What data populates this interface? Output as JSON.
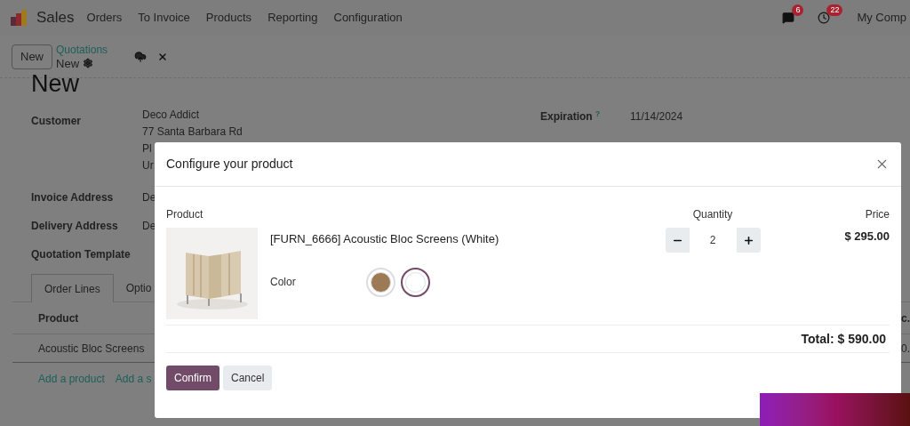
{
  "nav": {
    "app": "Sales",
    "menu": [
      "Orders",
      "To Invoice",
      "Products",
      "Reporting",
      "Configuration"
    ],
    "messages_badge": "6",
    "activities_badge": "22",
    "company": "My Comp"
  },
  "control_panel": {
    "new_button": "New",
    "breadcrumb": "Quotations",
    "record": "New"
  },
  "form": {
    "title": "New",
    "fields": [
      {
        "label": "Customer",
        "lines": [
          "Deco Addict",
          "77 Santa Barbara Rd",
          "Pl",
          "Ur"
        ]
      },
      {
        "label": "Invoice Address",
        "lines": [
          "De"
        ]
      },
      {
        "label": "Delivery Address",
        "lines": [
          "De"
        ]
      },
      {
        "label": "Quotation Template"
      }
    ],
    "expiration": {
      "label": "Expiration",
      "help": "?",
      "value": "11/14/2024"
    }
  },
  "tabs": [
    {
      "label": "Order Lines",
      "selected": true
    },
    {
      "label": "Optio",
      "selected": false
    }
  ],
  "order_lines": {
    "columns": [
      "Product",
      "c."
    ],
    "rows": [
      [
        "Acoustic Bloc Screens",
        "0."
      ]
    ],
    "actions": [
      "Add a product",
      "Add a s"
    ]
  },
  "dialog": {
    "title": "Configure your product",
    "columns": [
      "Product",
      "Quantity",
      "Price"
    ],
    "product": {
      "name": "[FURN_6666] Acoustic Bloc Screens (White)",
      "attribute_label": "Color",
      "swatches": [
        {
          "color": "#9c7a55",
          "selected": false
        },
        {
          "color": "#ffffff",
          "selected": true
        }
      ],
      "quantity": "2",
      "price": "$ 295.00"
    },
    "total": "Total: $ 590.00",
    "buttons": [
      {
        "label": "Confirm",
        "kind": "primary"
      },
      {
        "label": "Cancel",
        "kind": "secondary"
      }
    ]
  }
}
